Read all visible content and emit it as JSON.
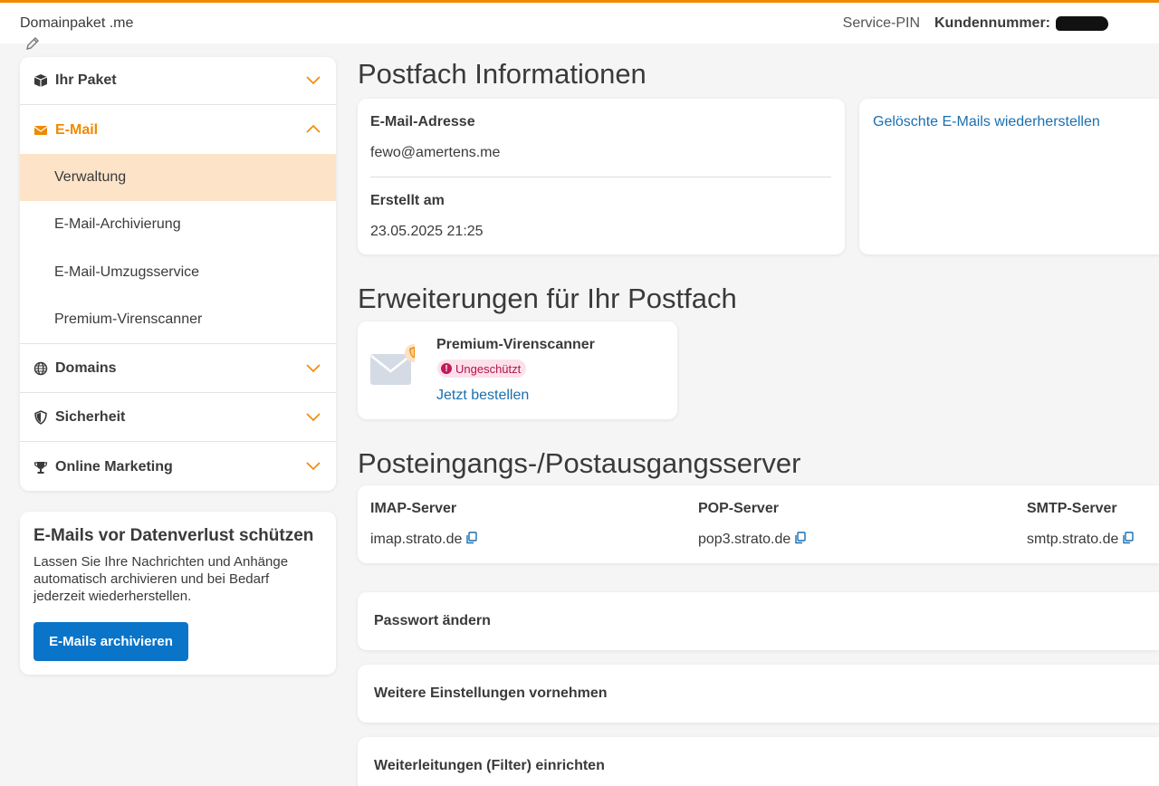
{
  "header": {
    "package_name": "Domainpaket .me",
    "service_pin": "Service-PIN",
    "customer_number_label": "Kundennummer:"
  },
  "sidebar": {
    "items": [
      {
        "label": "Ihr Paket",
        "icon": "box-icon"
      },
      {
        "label": "E-Mail",
        "icon": "envelope-icon",
        "active": true
      },
      {
        "label": "Domains",
        "icon": "globe-icon"
      },
      {
        "label": "Sicherheit",
        "icon": "shield-icon"
      },
      {
        "label": "Online Marketing",
        "icon": "trophy-icon"
      }
    ],
    "email_sub_items": [
      "Verwaltung",
      "E-Mail-Archivierung",
      "E-Mail-Umzugsservice",
      "Premium-Virenscanner"
    ],
    "selected_sub_item": "Verwaltung"
  },
  "promo": {
    "title": "E-Mails vor Datenverlust schützen",
    "text": "Lassen Sie Ihre Nachrichten und Anhänge automatisch archivieren und bei Bedarf jederzeit wiederherstellen.",
    "button_label": "E-Mails archivieren"
  },
  "mailbox": {
    "title": "Postfach Informationen",
    "email_label": "E-Mail-Adresse",
    "email_value": "fewo@amertens.me",
    "created_label": "Erstellt am",
    "created_value": "23.05.2025 21:25",
    "restore_link": "Gelöschte E-Mails wiederherstellen"
  },
  "extensions": {
    "title": "Erweiterungen für Ihr Postfach",
    "product_name": "Premium-Virenscanner",
    "status_badge": "Ungeschützt",
    "order_link": "Jetzt bestellen"
  },
  "servers": {
    "title": "Posteingangs-/Postausgangsserver",
    "imap_label": "IMAP-Server",
    "imap_value": "imap.strato.de",
    "pop_label": "POP-Server",
    "pop_value": "pop3.strato.de",
    "smtp_label": "SMTP-Server",
    "smtp_value": "smtp.strato.de"
  },
  "actions": [
    "Passwort ändern",
    "Weitere Einstellungen vornehmen",
    "Weiterleitungen (Filter) einrichten"
  ],
  "colors": {
    "accent": "#f08a00",
    "primary_button": "#0a74c9",
    "link": "#1a6fb0",
    "selected_bg": "#fde3c8",
    "badge_bg": "#fde1ea",
    "badge_text": "#b3124d"
  }
}
